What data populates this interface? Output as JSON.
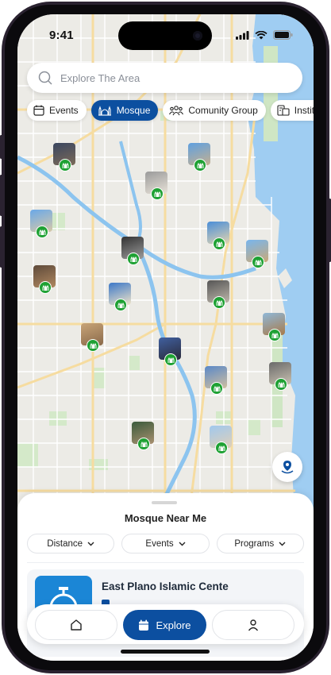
{
  "status_bar": {
    "time": "9:41"
  },
  "search": {
    "placeholder": "Explore The Area",
    "value": ""
  },
  "categories": [
    {
      "label": "Events",
      "icon": "calendar-icon",
      "active": false
    },
    {
      "label": "Mosque",
      "icon": "mosque-icon",
      "active": true
    },
    {
      "label": "Comunity Group",
      "icon": "people-icon",
      "active": false
    },
    {
      "label": "Institution",
      "icon": "institution-icon",
      "active": false
    }
  ],
  "map": {
    "pin_count": 17,
    "pin_badge_color": "#1ea133",
    "water_color": "#9fcdf2"
  },
  "sheet": {
    "title": "Mosque Near Me",
    "filters": [
      {
        "label": "Distance"
      },
      {
        "label": "Events"
      },
      {
        "label": "Programs"
      }
    ],
    "card": {
      "title": "East Plano Islamic Cente"
    }
  },
  "nav": {
    "home_icon": "home-icon",
    "explore_label": "Explore",
    "profile_icon": "profile-icon"
  },
  "colors": {
    "accent": "#0c4fa0",
    "badge": "#1ea133"
  }
}
